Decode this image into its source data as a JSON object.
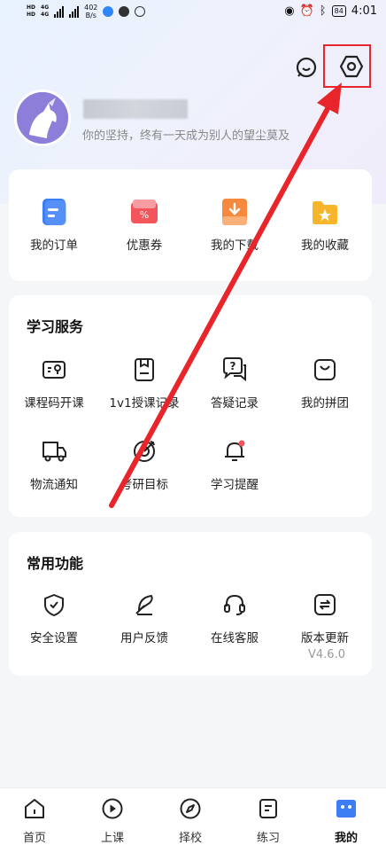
{
  "status_bar": {
    "hd1": "HD",
    "hd2": "HD",
    "net1": "4G",
    "net2": "4G",
    "speed_value": "402",
    "speed_unit": "B/s",
    "battery": "84",
    "time": "4:01"
  },
  "profile": {
    "motto": "你的坚持，终有一天成为别人的望尘莫及"
  },
  "quick_actions": [
    {
      "label": "我的订单",
      "icon": "order-icon",
      "color": "#3d7ef5"
    },
    {
      "label": "优惠券",
      "icon": "coupon-icon",
      "color": "#f2555a"
    },
    {
      "label": "我的下载",
      "icon": "download-icon",
      "color": "#f5893d"
    },
    {
      "label": "我的收藏",
      "icon": "favorite-folder-icon",
      "color": "#f7b52b"
    }
  ],
  "study_services": {
    "title": "学习服务",
    "items": [
      {
        "label": "课程码开课",
        "icon": "course-code-icon"
      },
      {
        "label": "1v1授课记录",
        "icon": "tutoring-record-icon"
      },
      {
        "label": "答疑记录",
        "icon": "qa-record-icon"
      },
      {
        "label": "我的拼团",
        "icon": "group-buy-icon"
      },
      {
        "label": "物流通知",
        "icon": "truck-icon"
      },
      {
        "label": "考研目标",
        "icon": "target-icon"
      },
      {
        "label": "学习提醒",
        "icon": "bell-icon"
      }
    ]
  },
  "common_functions": {
    "title": "常用功能",
    "items": [
      {
        "label": "安全设置",
        "icon": "shield-icon"
      },
      {
        "label": "用户反馈",
        "icon": "feather-icon"
      },
      {
        "label": "在线客服",
        "icon": "headset-icon"
      },
      {
        "label": "版本更新",
        "icon": "update-icon"
      }
    ],
    "version": "V4.6.0"
  },
  "tabbar": [
    {
      "label": "首页",
      "icon": "home-icon"
    },
    {
      "label": "上课",
      "icon": "play-icon"
    },
    {
      "label": "择校",
      "icon": "compass-icon"
    },
    {
      "label": "练习",
      "icon": "practice-icon"
    },
    {
      "label": "我的",
      "icon": "profile-icon",
      "active": true
    }
  ],
  "colors": {
    "accent_blue": "#3d7ef5",
    "annotation_red": "#e8252a"
  }
}
